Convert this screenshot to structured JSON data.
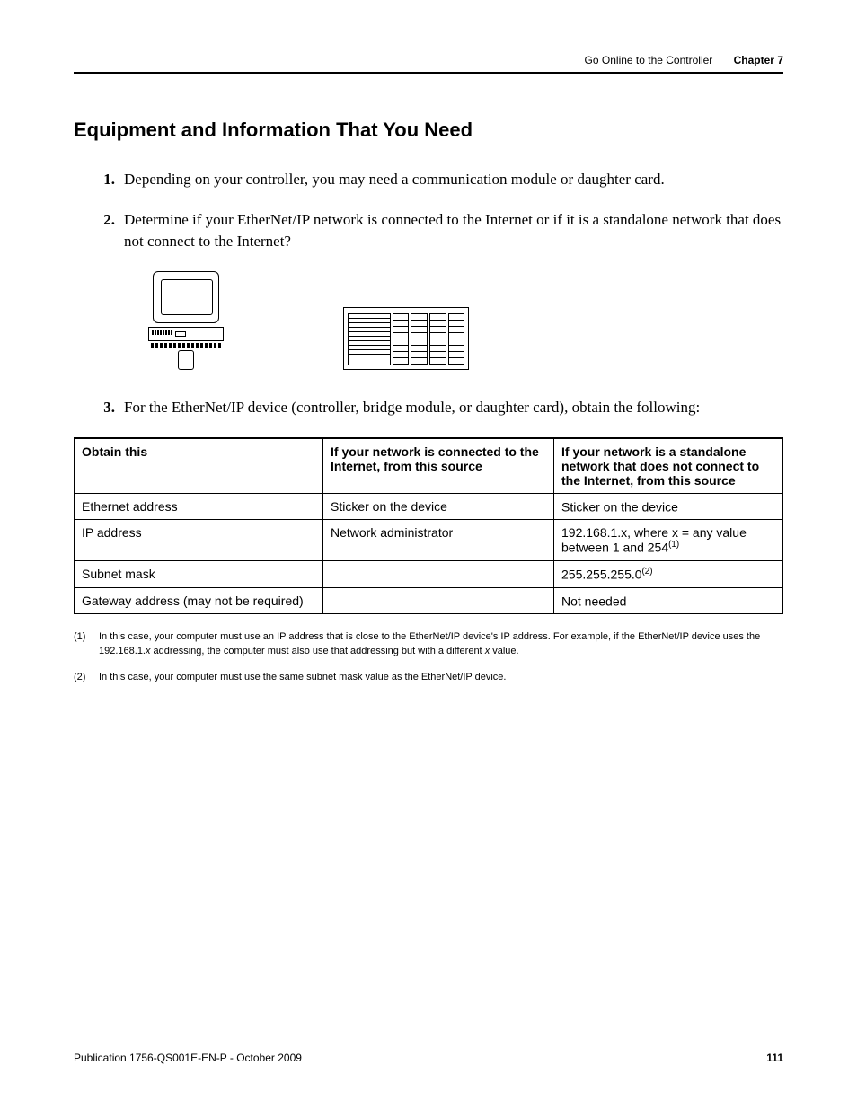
{
  "header": {
    "breadcrumb": "Go Online to the Controller",
    "chapter": "Chapter 7"
  },
  "section_title": "Equipment and Information That You Need",
  "steps": [
    {
      "num": "1.",
      "text": "Depending on your controller, you may need a communication module or daughter card."
    },
    {
      "num": "2.",
      "text": "Determine if your EtherNet/IP network is connected to the Internet or if it is a standalone network that does not connect to the Internet?"
    },
    {
      "num": "3.",
      "text": "For the EtherNet/IP device (controller, bridge module, or daughter card), obtain the following:"
    }
  ],
  "table": {
    "headers": {
      "c1": "Obtain this",
      "c2": "If your network is connected to the Internet, from this source",
      "c3": "If your network is a standalone network that does not connect to the Internet, from this source"
    },
    "rows": [
      {
        "c1": "Ethernet address",
        "c2": "Sticker on the device",
        "c3": "Sticker on the device",
        "c3_sup": ""
      },
      {
        "c1": "IP address",
        "c2": "Network administrator",
        "c3": "192.168.1.x, where x = any value between 1 and 254",
        "c3_sup": "(1)"
      },
      {
        "c1": "Subnet mask",
        "c2": "",
        "c3": "255.255.255.0",
        "c3_sup": "(2)"
      },
      {
        "c1": "Gateway address (may not be required)",
        "c2": "",
        "c3": "Not needed",
        "c3_sup": ""
      }
    ]
  },
  "footnotes": [
    {
      "mark": "(1)",
      "text_a": "In this case, your computer must use an IP address that is close to the EtherNet/IP device's IP address. For example, if the EtherNet/IP device uses the 192.168.1.",
      "text_b": " addressing, the computer must also use that addressing but with a different ",
      "text_c": " value."
    },
    {
      "mark": "(2)",
      "text_a": "In this case, your computer must use the same subnet mask value as the EtherNet/IP device.",
      "text_b": "",
      "text_c": ""
    }
  ],
  "footer": {
    "pub": "Publication 1756-QS001E-EN-P - October 2009",
    "page": "111"
  }
}
